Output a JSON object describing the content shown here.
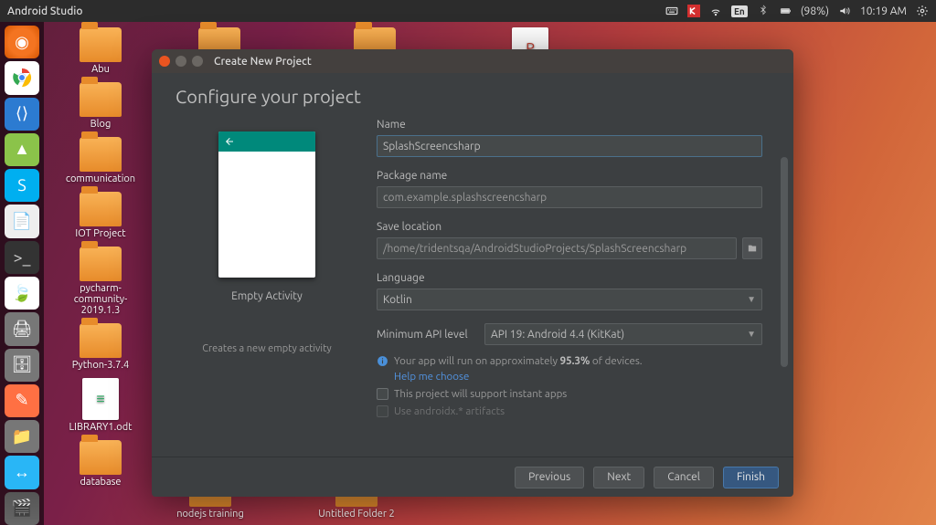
{
  "panel": {
    "app_title": "Android Studio",
    "battery": "(98%)",
    "time": "10:19 AM",
    "lang": "En"
  },
  "desktop_icons": {
    "col": [
      "Abu",
      "Blog",
      "communication",
      "IOT Project",
      "pycharm-community-2019.1.3",
      "Python-3.7.4",
      "LIBRARY1.odt",
      "database"
    ],
    "bottom": [
      "nodejs training",
      "Untitled Folder 2"
    ]
  },
  "dialog": {
    "window_title": "Create New Project",
    "heading": "Configure your project",
    "template_name": "Empty Activity",
    "template_desc": "Creates a new empty activity",
    "labels": {
      "name": "Name",
      "package": "Package name",
      "save": "Save location",
      "language": "Language",
      "min_api": "Minimum API level"
    },
    "values": {
      "name": "SplashScreencsharp",
      "package": "com.example.splashscreencsharp",
      "save": "/home/tridentsqa/AndroidStudioProjects/SplashScreencsharp",
      "language": "Kotlin",
      "min_api": "API 19: Android 4.4 (KitKat)"
    },
    "info_prefix": "Your app will run on approximately ",
    "info_pct": "95.3%",
    "info_suffix": " of devices.",
    "help_link": "Help me choose",
    "chk_instant": "This project will support instant apps",
    "chk_androidx": "Use androidx.* artifacts",
    "buttons": {
      "prev": "Previous",
      "next": "Next",
      "cancel": "Cancel",
      "finish": "Finish"
    }
  }
}
